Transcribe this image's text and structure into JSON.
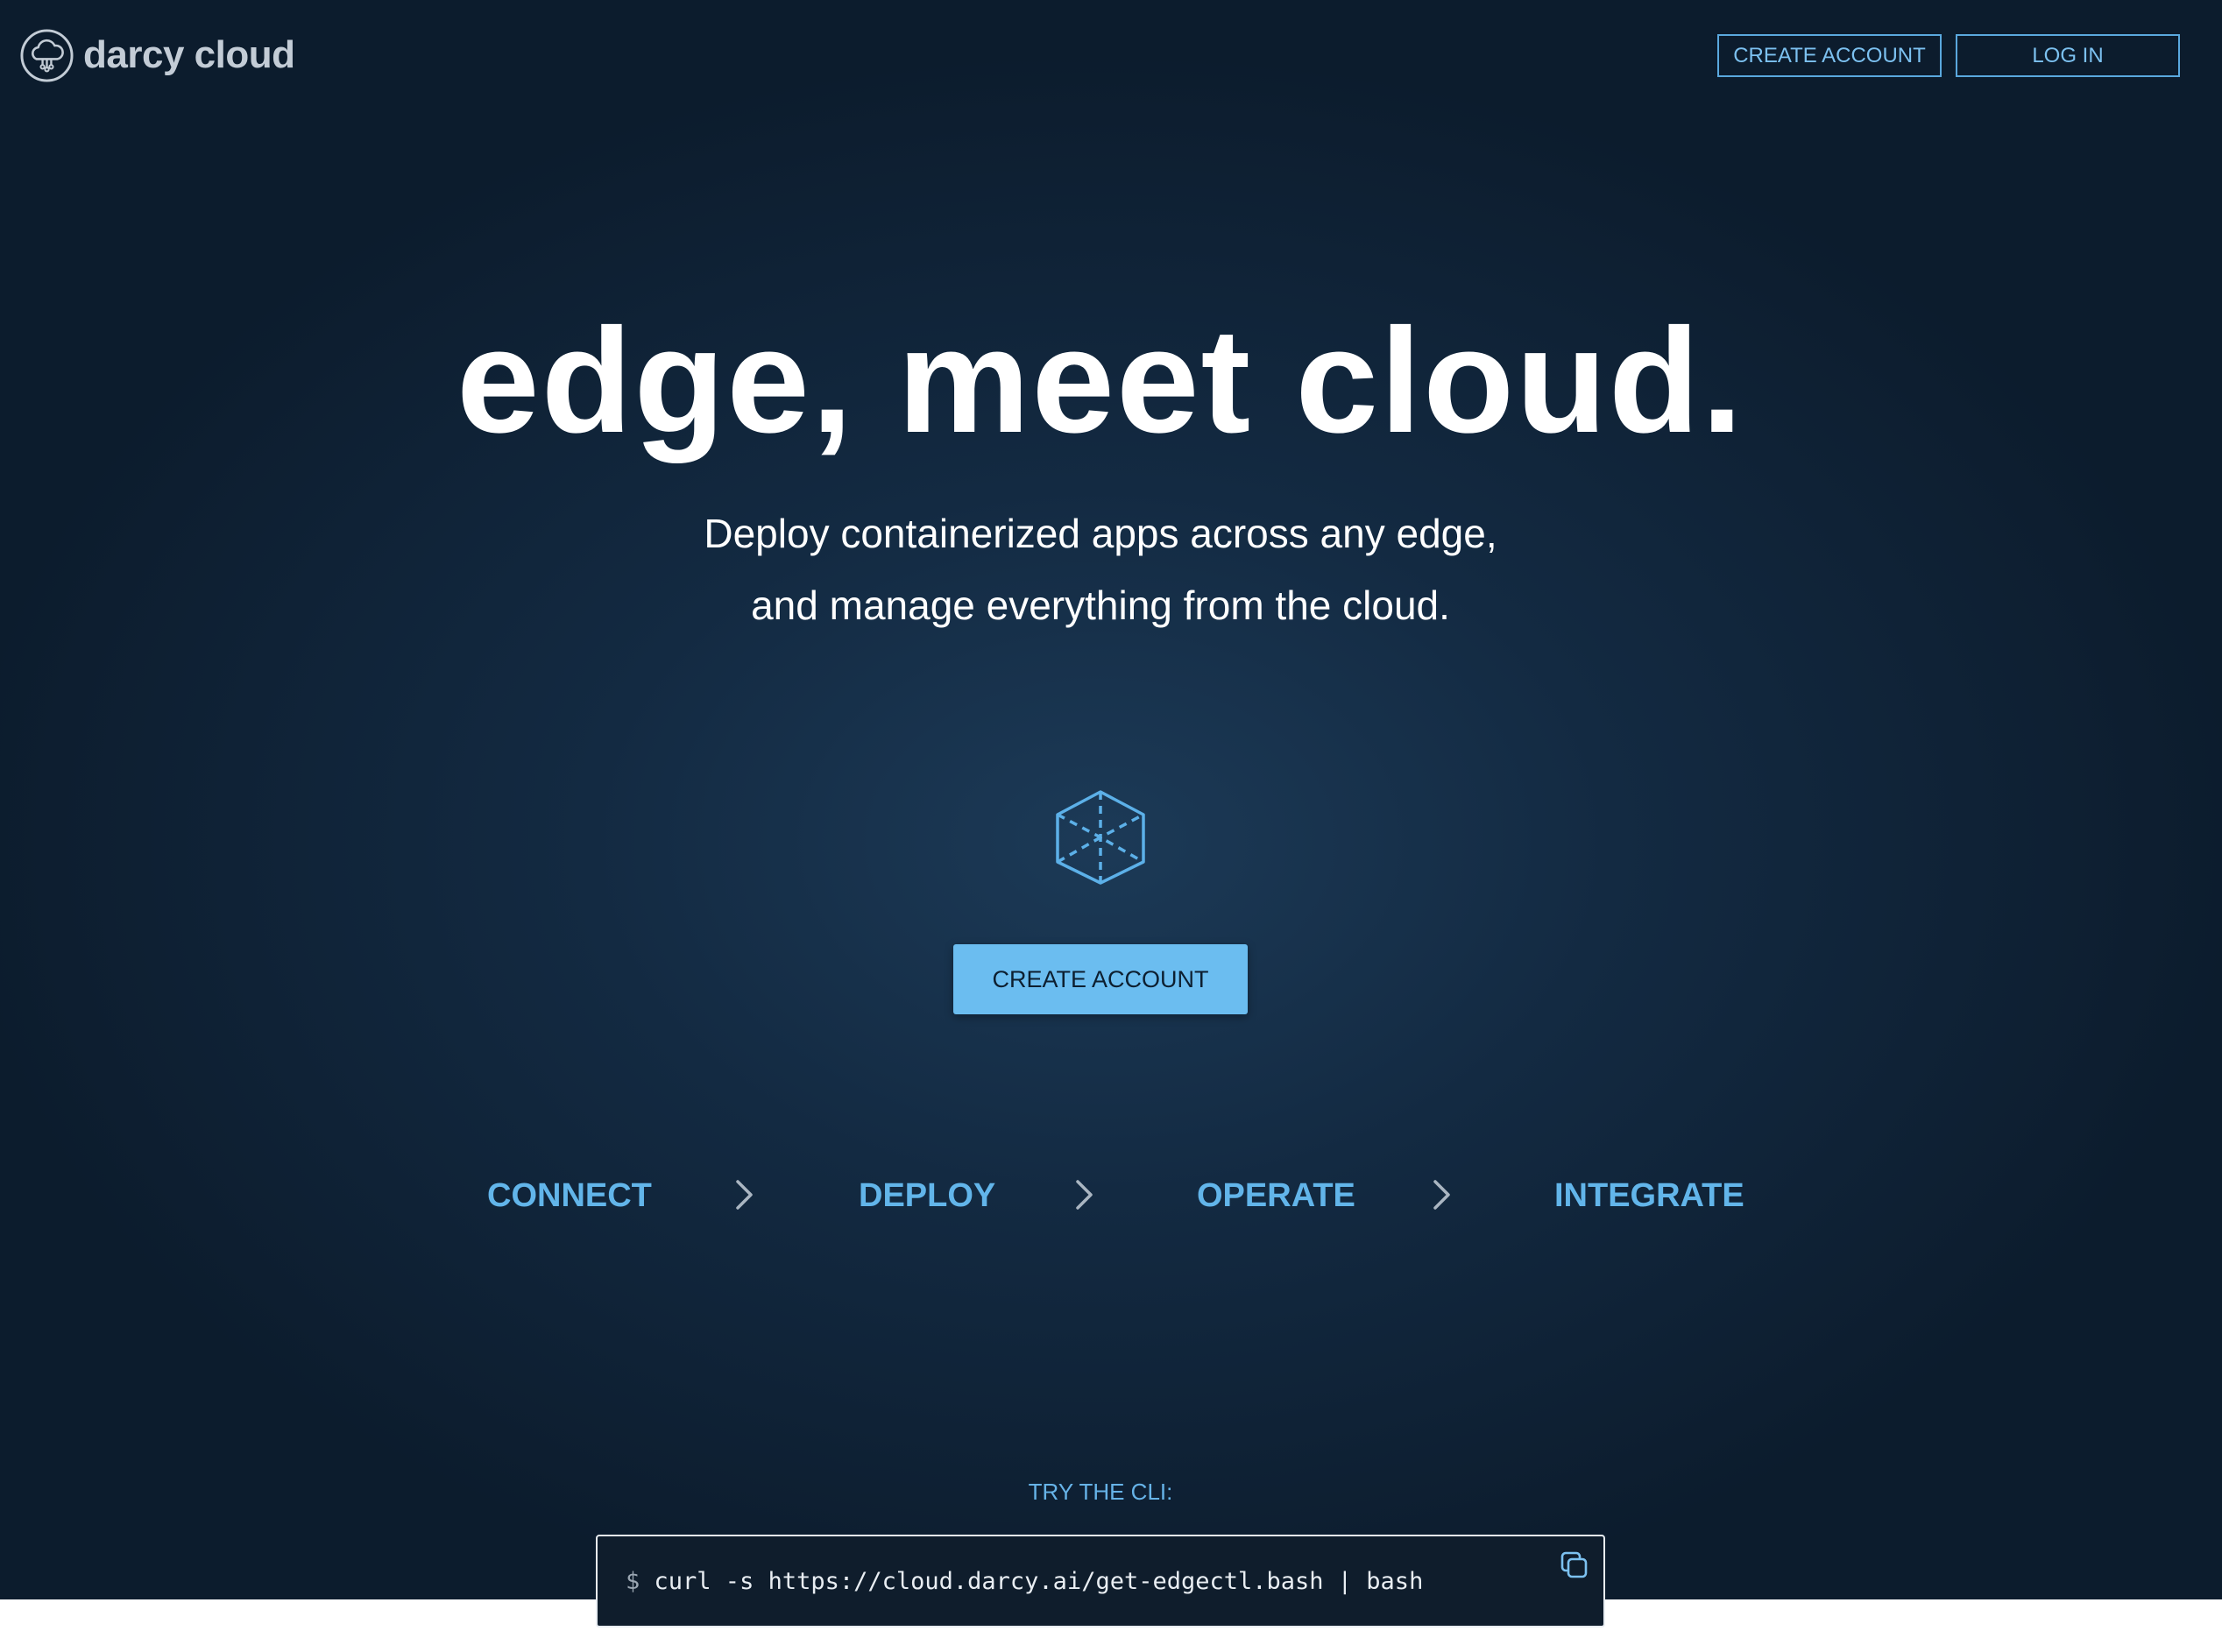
{
  "colors": {
    "background_dark": "#0c1c2d",
    "background_center": "#1c3a57",
    "accent": "#62b5ea",
    "cta_fill": "#6bbdf0",
    "cli_background": "#0f1d2c"
  },
  "header": {
    "logo_text": "darcy cloud",
    "logo_icon": "cloud-circuit-icon",
    "create_account_label": "CREATE ACCOUNT",
    "login_label": "LOG IN"
  },
  "hero": {
    "headline": "edge, meet cloud.",
    "subline_1": "Deploy containerized apps across any edge,",
    "subline_2": "and manage everything from the cloud.",
    "hero_icon": "cube-icon",
    "cta_label": "CREATE ACCOUNT"
  },
  "steps": {
    "items": [
      {
        "label": "CONNECT"
      },
      {
        "label": "DEPLOY"
      },
      {
        "label": "OPERATE"
      },
      {
        "label": "INTEGRATE"
      }
    ],
    "separator_icon": "chevron-right-icon"
  },
  "cli": {
    "label": "TRY THE CLI:",
    "prompt": "$",
    "command": "curl -s https://cloud.darcy.ai/get-edgectl.bash | bash",
    "copy_icon": "copy-icon"
  }
}
